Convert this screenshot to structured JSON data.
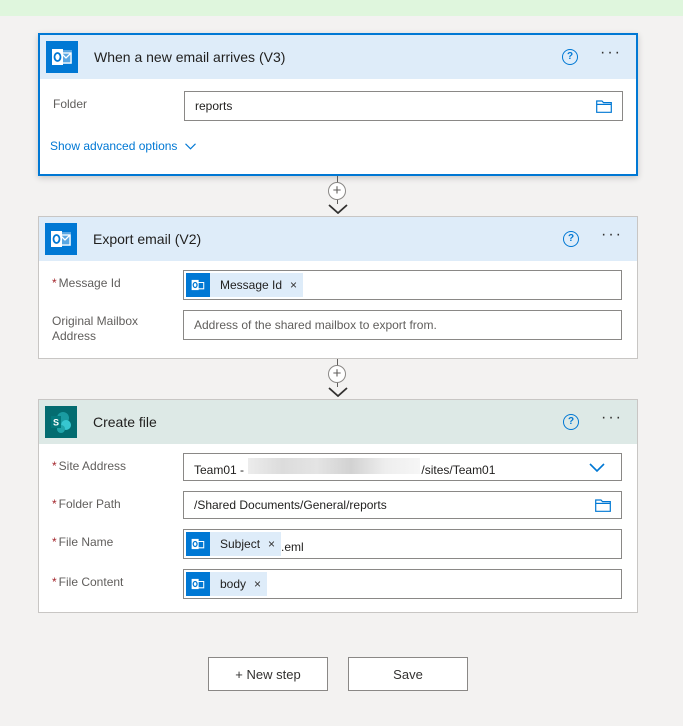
{
  "trigger": {
    "title": "When a new email arrives (V3)",
    "folder_label": "Folder",
    "folder_value": "reports",
    "advanced_link": "Show advanced options"
  },
  "export": {
    "title": "Export email (V2)",
    "message_id_label": "Message Id",
    "message_id_token": "Message Id",
    "mailbox_label_1": "Original Mailbox",
    "mailbox_label_2": "Address",
    "mailbox_placeholder": "Address of the shared mailbox to export from."
  },
  "create_file": {
    "title": "Create file",
    "site_label": "Site Address",
    "site_value_prefix": "Team01 -",
    "site_value_suffix": "/sites/Team01",
    "folder_label": "Folder Path",
    "folder_value": "/Shared Documents/General/reports",
    "name_label": "File Name",
    "name_token": "Subject",
    "name_suffix": ".eml",
    "content_label": "File Content",
    "content_token": "body"
  },
  "required_marker": "*",
  "token_close": "×",
  "more_glyph": "···",
  "help_glyph": "?",
  "plus_glyph": "+",
  "buttons": {
    "new_step": "+ New step",
    "save": "Save"
  },
  "icons": {
    "outlook": "outlook-icon",
    "sharepoint": "sharepoint-icon",
    "folder": "folder-icon",
    "chevron": "chevron-down-icon"
  },
  "colors": {
    "accent": "#0078d4",
    "outlook_header": "#deecf9",
    "sharepoint_header": "#dde9e6",
    "sharepoint_brand": "#036c70",
    "required": "#a4262c"
  }
}
